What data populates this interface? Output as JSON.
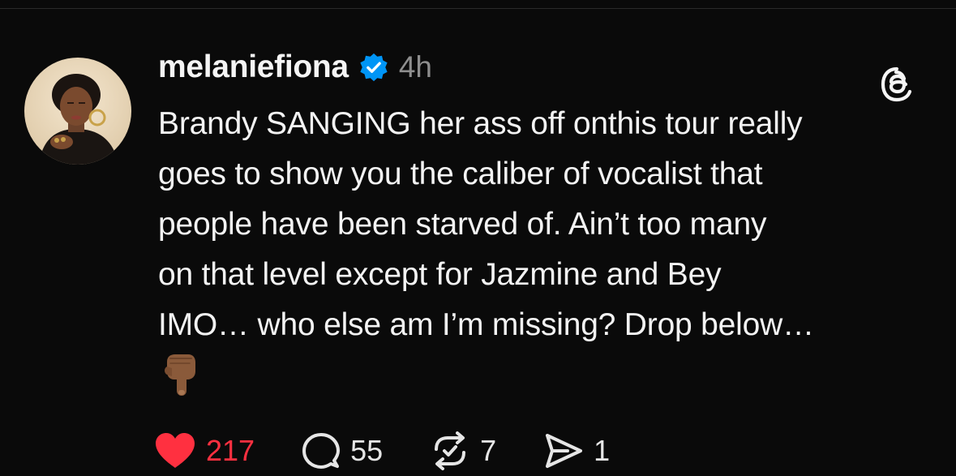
{
  "post": {
    "username": "melaniefiona",
    "timestamp": "4h",
    "text": "Brandy SANGING her ass off onthis tour really\ngoes to show you the caliber of vocalist that\npeople have been starved of. Ain’t too many\non that level except for Jazmine and Bey\nIMO… who else am I’m missing? Drop below…",
    "emoji": "backhand-index-pointing-down-medium-dark-skin-tone"
  },
  "actions": {
    "likes": "217",
    "replies": "55",
    "reposts": "7",
    "shares": "1"
  },
  "colors": {
    "background": "#0a0a0a",
    "text": "#f3f3f3",
    "muted": "#8e8e8e",
    "like": "#ff3040",
    "verified": "#0095f6"
  },
  "icons": {
    "verified": "verified-badge-icon",
    "app": "threads-logo-icon",
    "like": "heart-icon",
    "reply": "comment-icon",
    "repost": "repost-icon",
    "share": "send-icon"
  }
}
